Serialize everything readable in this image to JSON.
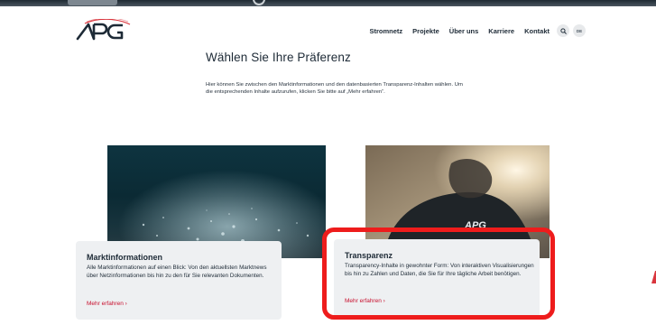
{
  "nav": {
    "items": [
      "Stromnetz",
      "Projekte",
      "Über uns",
      "Karriere",
      "Kontakt"
    ],
    "language": "DE"
  },
  "page": {
    "title": "Wählen Sie Ihre Präferenz",
    "intro": "Hier können Sie zwischen den Marktinformationen und den datenbasierten Transparenz-Inhalten wählen. Um die entsprechenden Inhalte aufzurufen, klicken Sie bitte auf „Mehr erfahren“."
  },
  "cards": [
    {
      "title": "Marktinformationen",
      "text": "Alle Marktinformationen auf einen Blick: Von den aktuellsten Marktnews über Netzinformationen bis hin zu den für Sie relevanten Dokumenten.",
      "link": "Mehr erfahren  ›"
    },
    {
      "title": "Transparenz",
      "text": "Transparency-Inhalte in gewohnter Form: Von interaktiven Visualisierungen bis hin zu Zahlen und Daten, die Sie für Ihre tägliche Arbeit benötigen.",
      "link": "Mehr erfahren  ›"
    }
  ],
  "colors": {
    "accent": "#c8102e",
    "highlight": "#ee1c1c",
    "text": "#1d2a36",
    "card_bg": "#eef0f2"
  }
}
